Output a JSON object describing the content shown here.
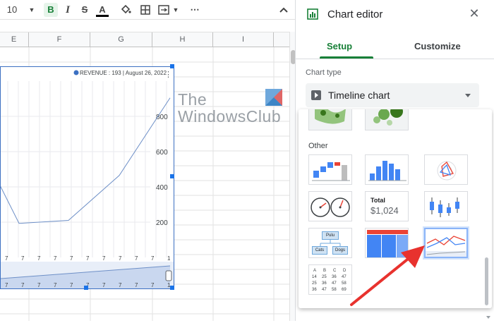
{
  "toolbar": {
    "font_size": "10",
    "bold_label": "B",
    "italic_label": "I",
    "strike_label": "S",
    "text_color_label": "A",
    "more_label": "⋯"
  },
  "sheet": {
    "columns": [
      "E",
      "F",
      "G",
      "H",
      "I"
    ]
  },
  "chart_data": {
    "type": "line",
    "legend": "REVENUE : 193  | August 26, 2022",
    "y_ticks": [
      "800",
      "600",
      "400",
      "200"
    ],
    "x_tick_label": "7",
    "x_tick_end": "1",
    "series": [
      {
        "values": [
          193,
          210,
          465,
          905
        ]
      }
    ],
    "ylim": [
      0,
      1000
    ]
  },
  "watermark": {
    "line1": "The",
    "line2": "WindowsClub"
  },
  "editor": {
    "title": "Chart editor",
    "tabs": {
      "setup": "Setup",
      "customize": "Customize"
    },
    "chart_type_label": "Chart type",
    "chart_type_value": "Timeline chart",
    "other_label": "Other",
    "scorecard_title": "Total",
    "scorecard_value": "$1,024",
    "org_nodes": [
      "Pulu",
      "Cats",
      "Dogs"
    ],
    "table_rows": [
      [
        "A",
        "B",
        "C",
        "D"
      ],
      [
        "14",
        "25",
        "36",
        "47"
      ],
      [
        "25",
        "36",
        "47",
        "58"
      ],
      [
        "36",
        "47",
        "58",
        "69"
      ]
    ]
  },
  "colors": {
    "accent_green": "#188038",
    "selection_blue": "#1a73e8",
    "arrow_red": "#e8322e"
  }
}
